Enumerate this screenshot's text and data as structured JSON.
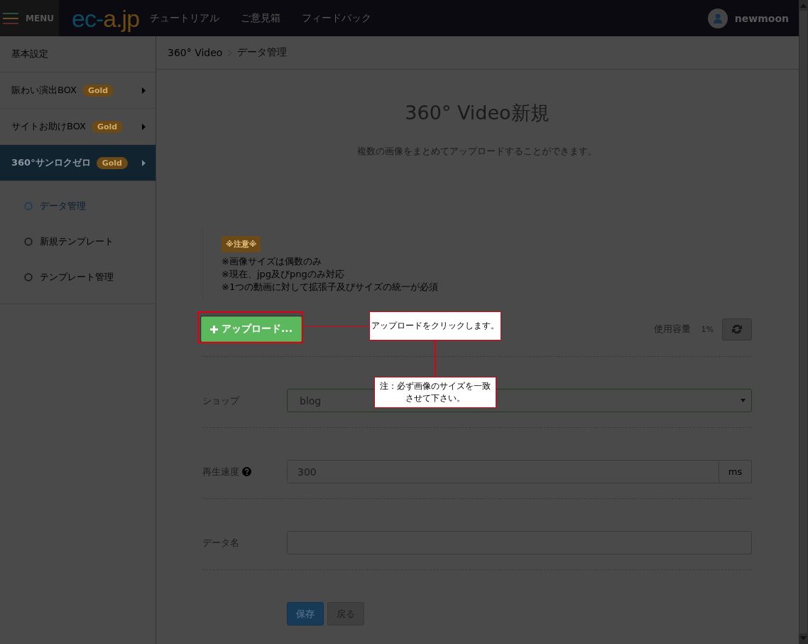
{
  "header": {
    "menu_label": "MENU",
    "logo": {
      "first": "ec-",
      "second": "a.jp"
    },
    "nav": [
      {
        "label": "チュートリアル"
      },
      {
        "label": "ご意見箱"
      },
      {
        "label": "フィードバック"
      }
    ],
    "user": "newmoon"
  },
  "sidebar": {
    "items": [
      {
        "label": "基本設定",
        "selected": false
      },
      {
        "label": "賑わい演出BOX",
        "badge": "Gold",
        "has_arrow": true,
        "selected": false
      },
      {
        "label": "サイトお助けBOX",
        "badge": "Gold",
        "has_arrow": true,
        "selected": false
      },
      {
        "label": "360°サンロクゼロ",
        "badge": "Gold",
        "has_arrow": true,
        "selected": true,
        "expanded": true,
        "children": [
          {
            "label": "データ管理",
            "selected": true
          },
          {
            "label": "新規テンプレート",
            "selected": false
          },
          {
            "label": "テンプレート管理",
            "selected": false
          }
        ]
      }
    ]
  },
  "breadcrumb": [
    {
      "label": "360° Video"
    },
    {
      "label": "データ管理"
    }
  ],
  "title": "360° Video新規",
  "subtitle": "複数の画像をまとめてアップロードすることができます。",
  "notice": {
    "tag": "※注意※",
    "lines": [
      "※画像サイズは偶数のみ",
      "※現在、jpg及びpngのみ対応",
      "※1つの動画に対して拡張子及びサイズの統一が必須"
    ]
  },
  "upload_button": {
    "label": "アップロード...",
    "highlighted": true
  },
  "usage": {
    "label": "使用容量",
    "value": "1%"
  },
  "form": [
    {
      "kind": "select",
      "label": "ショップ",
      "value": "blog"
    },
    {
      "kind": "addon",
      "label": "再生速度",
      "help": true,
      "value": "300",
      "addon": "ms"
    },
    {
      "kind": "text",
      "label": "データ名"
    }
  ],
  "buttons": [
    {
      "label": "保存",
      "kind": "primary"
    },
    {
      "label": "戻る",
      "kind": "default"
    }
  ],
  "callouts": [
    {
      "text": "アップロードをクリックします。"
    },
    {
      "text": "注：必ず画像のサイズを一致させて下さい。"
    }
  ]
}
